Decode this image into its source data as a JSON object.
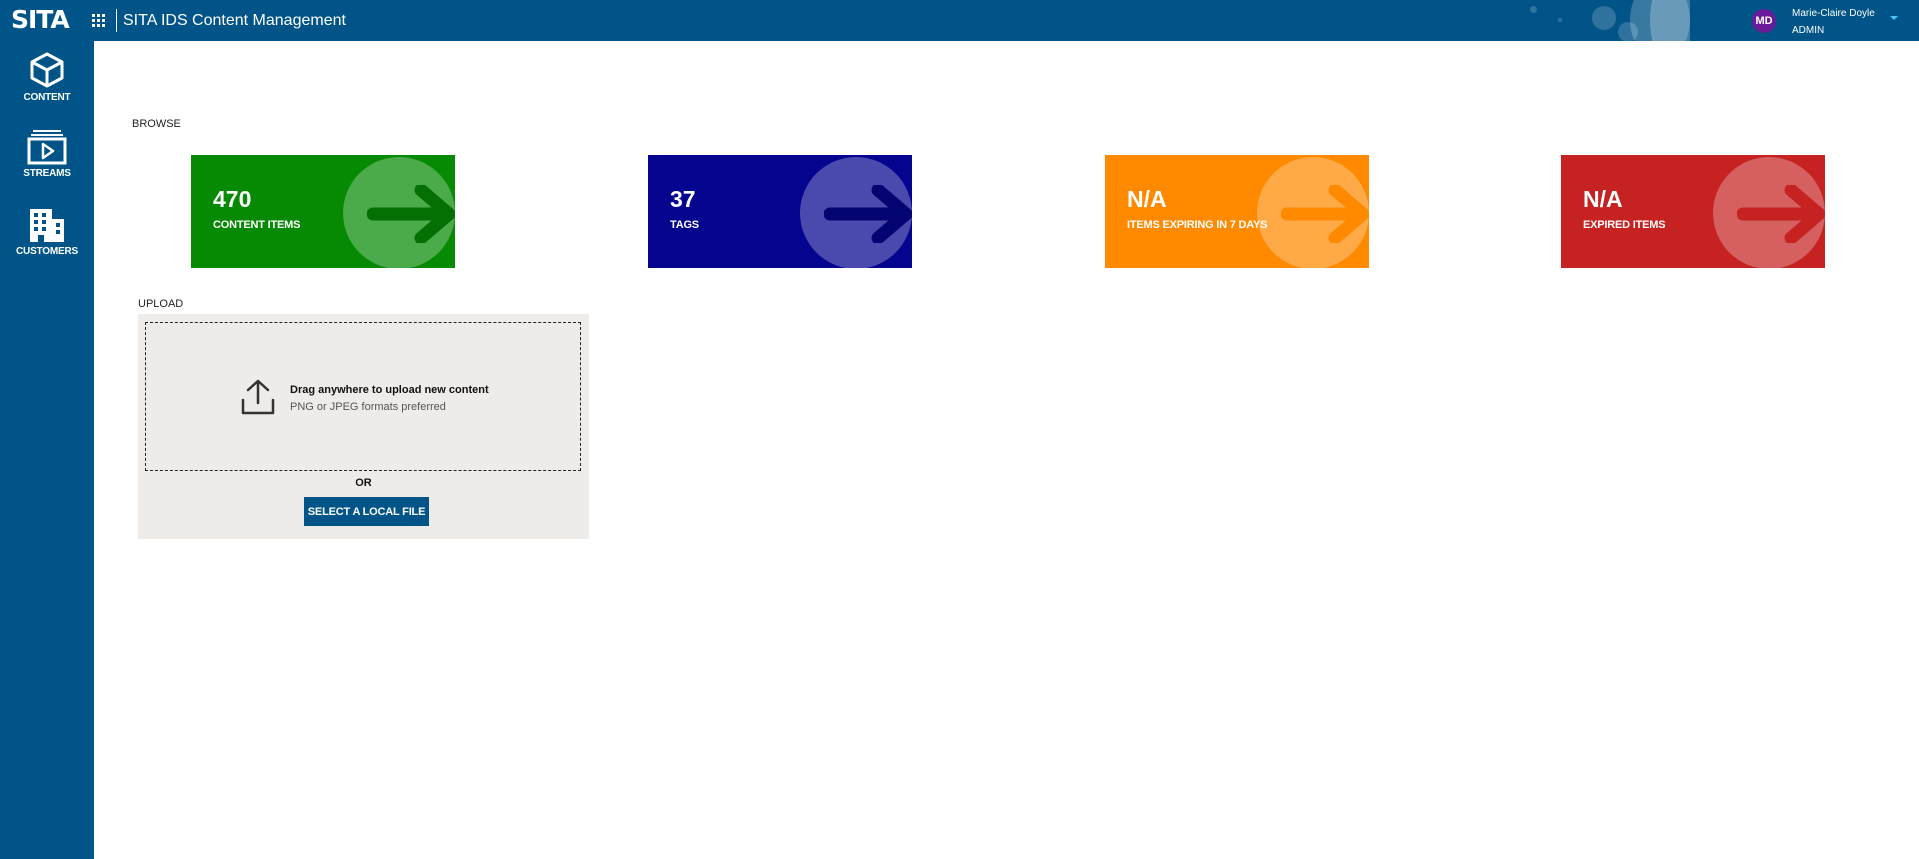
{
  "header": {
    "logo": "SITA",
    "app_title": "SITA IDS Content Management",
    "user": {
      "initials": "MD",
      "name": "Marie-Claire Doyle",
      "role": "ADMIN"
    }
  },
  "sidebar": {
    "items": [
      {
        "label": "CONTENT",
        "icon": "cube-icon"
      },
      {
        "label": "STREAMS",
        "icon": "play-screen-icon"
      },
      {
        "label": "CUSTOMERS",
        "icon": "building-icon"
      }
    ]
  },
  "browse": {
    "section_label": "BROWSE",
    "tiles": [
      {
        "value": "470",
        "label": "CONTENT ITEMS",
        "color": "#068a04",
        "arrow_color": "#047003"
      },
      {
        "value": "37",
        "label": "TAGS",
        "color": "#04048f",
        "arrow_color": "#030372"
      },
      {
        "value": "N/A",
        "label": "ITEMS EXPIRING IN 7 DAYS",
        "color": "#ff8a00",
        "arrow_color": "#ff8a00"
      },
      {
        "value": "N/A",
        "label": "EXPIRED ITEMS",
        "color": "#c62222",
        "arrow_color": "#c62222"
      }
    ]
  },
  "upload": {
    "section_label": "UPLOAD",
    "drop_title": "Drag anywhere to upload new content",
    "drop_subtitle": "PNG or JPEG formats preferred",
    "or_text": "OR",
    "select_button": "SELECT A LOCAL FILE"
  }
}
